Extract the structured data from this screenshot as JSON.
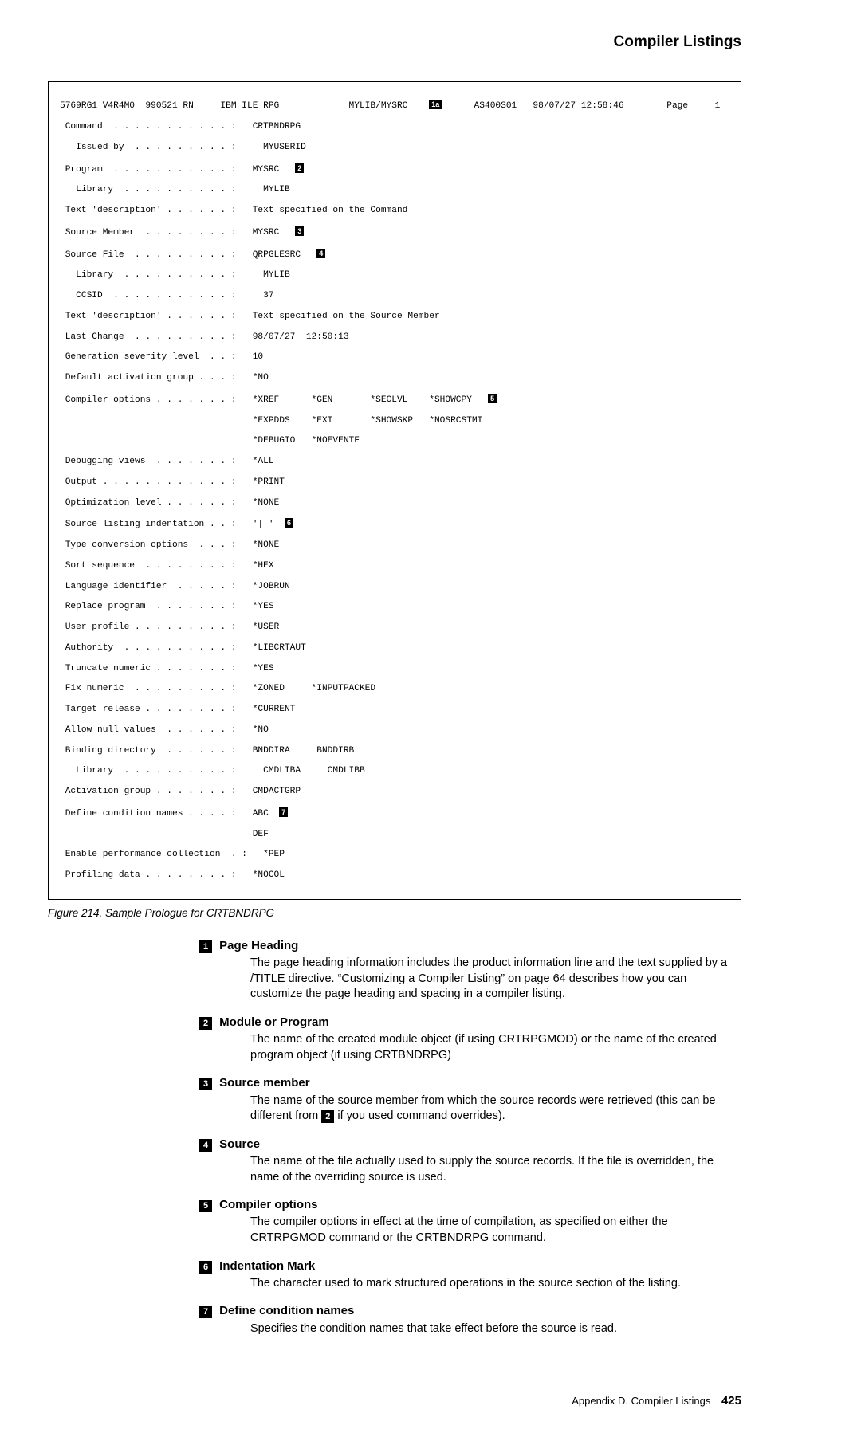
{
  "header": {
    "title": "Compiler Listings"
  },
  "listing": {
    "l01a": "5769RG1 V4R4M0  990521 RN     IBM ILE RPG             MYLIB/MYSRC    ",
    "l01b": "      AS400S01   98/07/27 12:58:46        Page     1",
    "l02": " Command  . . . . . . . . . . . :   CRTBNDRPG",
    "l03": "   Issued by  . . . . . . . . . :     MYUSERID",
    "l04a": " Program  . . . . . . . . . . . :   MYSRC   ",
    "l05": "   Library  . . . . . . . . . . :     MYLIB",
    "l06": " Text 'description' . . . . . . :   Text specified on the Command",
    "l07a": " Source Member  . . . . . . . . :   MYSRC   ",
    "l08a": " Source File  . . . . . . . . . :   QRPGLESRC   ",
    "l09": "   Library  . . . . . . . . . . :     MYLIB",
    "l10": "   CCSID  . . . . . . . . . . . :     37",
    "l11": " Text 'description' . . . . . . :   Text specified on the Source Member",
    "l12": " Last Change  . . . . . . . . . :   98/07/27  12:50:13",
    "l13": " Generation severity level  . . :   10",
    "l14": " Default activation group . . . :   *NO",
    "l15a": " Compiler options . . . . . . . :   *XREF      *GEN       *SECLVL    *SHOWCPY   ",
    "l16": "                                    *EXPDDS    *EXT       *SHOWSKP   *NOSRCSTMT",
    "l17": "                                    *DEBUGIO   *NOEVENTF",
    "l18": " Debugging views  . . . . . . . :   *ALL",
    "l19": " Output . . . . . . . . . . . . :   *PRINT",
    "l20": " Optimization level . . . . . . :   *NONE",
    "l21a": " Source listing indentation . . :   '| '  ",
    "l22": " Type conversion options  . . . :   *NONE",
    "l23": " Sort sequence  . . . . . . . . :   *HEX",
    "l24": " Language identifier  . . . . . :   *JOBRUN",
    "l25": " Replace program  . . . . . . . :   *YES",
    "l26": " User profile . . . . . . . . . :   *USER",
    "l27": " Authority  . . . . . . . . . . :   *LIBCRTAUT",
    "l28": " Truncate numeric . . . . . . . :   *YES",
    "l29": " Fix numeric  . . . . . . . . . :   *ZONED     *INPUTPACKED",
    "l30": " Target release . . . . . . . . :   *CURRENT",
    "l31": " Allow null values  . . . . . . :   *NO",
    "l32": " Binding directory  . . . . . . :   BNDDIRA     BNDDIRB",
    "l33": "   Library  . . . . . . . . . . :     CMDLIBA     CMDLIBB",
    "l34": " Activation group . . . . . . . :   CMDACTGRP",
    "l35a": " Define condition names . . . . :   ABC  ",
    "l36": "                                    DEF",
    "l37": " Enable performance collection  . :   *PEP",
    "l38": " Profiling data . . . . . . . . :   *NOCOL",
    "callout1a": "1a",
    "callout2": "2",
    "callout3": "3",
    "callout4": "4",
    "callout5": "5",
    "callout6": "6",
    "callout7": "7"
  },
  "figure_caption": "Figure 214. Sample Prologue for CRTBNDRPG",
  "defs": [
    {
      "num": "1",
      "title": "Page Heading",
      "body_a": "The page heading information includes the product information line and the text supplied by a /TITLE directive. “Customizing a Compiler Listing” on page 64 describes how you can customize the page heading and spacing in a compiler listing."
    },
    {
      "num": "2",
      "title": "Module or Program",
      "body_a": "The name of the created module object (if using CRTRPGMOD) or the name of the created program object (if using CRTBNDRPG)"
    },
    {
      "num": "3",
      "title": "Source member",
      "body_a": "The name of the source member from which the source records were retrieved (this can be different from ",
      "body_b": " if you used command overrides)."
    },
    {
      "num": "4",
      "title": "Source",
      "body_a": "The name of the file actually used to supply the source records. If the file is overridden, the name of the overriding source is used."
    },
    {
      "num": "5",
      "title": "Compiler options",
      "body_a": "The compiler options in effect at the time of compilation, as specified on either the CRTRPGMOD command or the CRTBNDRPG command."
    },
    {
      "num": "6",
      "title": "Indentation Mark",
      "body_a": "The character used to mark structured operations in the source section of the listing."
    },
    {
      "num": "7",
      "title": "Define condition names",
      "body_a": "Specifies the condition names that take effect before the source is read."
    }
  ],
  "inline_callout_2": "2",
  "footer": {
    "text": "Appendix D. Compiler Listings",
    "page": "425"
  }
}
